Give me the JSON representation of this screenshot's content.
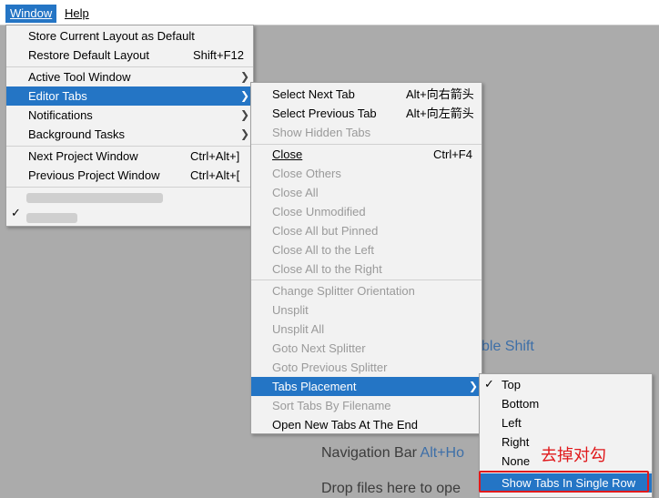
{
  "menubar": {
    "window": "Window",
    "help": "Help"
  },
  "background": {
    "shift_hint": "ble Shift",
    "nav_label": "Navigation Bar",
    "nav_key": "Alt+Ho",
    "drop": "Drop files here to ope"
  },
  "window_menu": [
    {
      "label": "Store Current Layout as Default",
      "shortcut": ""
    },
    {
      "label": "Restore Default Layout",
      "shortcut": "Shift+F12"
    },
    {
      "label": "Active Tool Window",
      "shortcut": ""
    },
    {
      "label": "Editor Tabs",
      "shortcut": ""
    },
    {
      "label": "Notifications",
      "shortcut": ""
    },
    {
      "label": "Background Tasks",
      "shortcut": ""
    },
    {
      "label": "Next Project Window",
      "shortcut": "Ctrl+Alt+]"
    },
    {
      "label": "Previous Project Window",
      "shortcut": "Ctrl+Alt+["
    }
  ],
  "editor_tabs_menu": [
    {
      "label": "Select Next Tab",
      "shortcut": "Alt+向右箭头"
    },
    {
      "label": "Select Previous Tab",
      "shortcut": "Alt+向左箭头"
    },
    {
      "label": "Show Hidden Tabs",
      "shortcut": ""
    },
    {
      "label": "Close",
      "shortcut": "Ctrl+F4"
    },
    {
      "label": "Close Others",
      "shortcut": ""
    },
    {
      "label": "Close All",
      "shortcut": ""
    },
    {
      "label": "Close Unmodified",
      "shortcut": ""
    },
    {
      "label": "Close All but Pinned",
      "shortcut": ""
    },
    {
      "label": "Close All to the Left",
      "shortcut": ""
    },
    {
      "label": "Close All to the Right",
      "shortcut": ""
    },
    {
      "label": "Change Splitter Orientation",
      "shortcut": ""
    },
    {
      "label": "Unsplit",
      "shortcut": ""
    },
    {
      "label": "Unsplit All",
      "shortcut": ""
    },
    {
      "label": "Goto Next Splitter",
      "shortcut": ""
    },
    {
      "label": "Goto Previous Splitter",
      "shortcut": ""
    },
    {
      "label": "Tabs Placement",
      "shortcut": ""
    },
    {
      "label": "Sort Tabs By Filename",
      "shortcut": ""
    },
    {
      "label": "Open New Tabs At The End",
      "shortcut": ""
    }
  ],
  "placement_menu": [
    {
      "label": "Top"
    },
    {
      "label": "Bottom"
    },
    {
      "label": "Left"
    },
    {
      "label": "Right"
    },
    {
      "label": "None"
    },
    {
      "label": "Show Tabs In Single Row"
    }
  ],
  "annotation": "去掉对勾",
  "colors": {
    "highlight": "#2475c5",
    "annotation": "#e0191c",
    "disabled": "#9a9a9a"
  },
  "icons": {
    "submenu": "chevron-right-icon",
    "check": "check-icon"
  }
}
